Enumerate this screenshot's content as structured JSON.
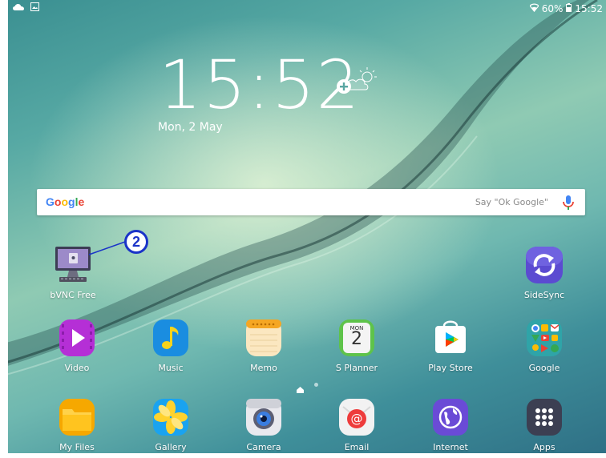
{
  "status_bar": {
    "battery_text": "60%",
    "time": "15:52",
    "icons": [
      "cloud-icon",
      "gallery-notification-icon",
      "wifi-icon",
      "battery-icon"
    ]
  },
  "clock_widget": {
    "time": "15:52",
    "date": "Mon, 2 May",
    "weather_icon": "partly-sunny-add-icon"
  },
  "google_search": {
    "logo": "Google",
    "hint": "Say \"Ok Google\"",
    "mic_icon": "microphone-icon",
    "colors": {
      "blue": "#4285F4",
      "red": "#EA4335",
      "yellow": "#FBBC05",
      "green": "#34A853"
    }
  },
  "annotation": {
    "number": "2"
  },
  "apps_row1": [
    {
      "label": "bVNC Free",
      "icon": "remote-desktop-icon"
    },
    {
      "label": "SideSync",
      "icon": "sidesync-icon"
    }
  ],
  "apps_row2": [
    {
      "label": "Video",
      "icon": "video-icon"
    },
    {
      "label": "Music",
      "icon": "music-icon"
    },
    {
      "label": "Memo",
      "icon": "memo-icon"
    },
    {
      "label": "S Planner",
      "icon": "calendar-icon",
      "day_name": "MON",
      "day_num": "2"
    },
    {
      "label": "Play Store",
      "icon": "play-store-icon"
    },
    {
      "label": "Google",
      "icon": "google-folder-icon"
    }
  ],
  "dock": [
    {
      "label": "My Files",
      "icon": "folder-icon"
    },
    {
      "label": "Gallery",
      "icon": "gallery-icon"
    },
    {
      "label": "Camera",
      "icon": "camera-icon"
    },
    {
      "label": "Email",
      "icon": "email-icon"
    },
    {
      "label": "Internet",
      "icon": "globe-icon"
    },
    {
      "label": "Apps",
      "icon": "apps-grid-icon"
    }
  ],
  "page_indicator": {
    "pages": 2,
    "current": 1
  }
}
